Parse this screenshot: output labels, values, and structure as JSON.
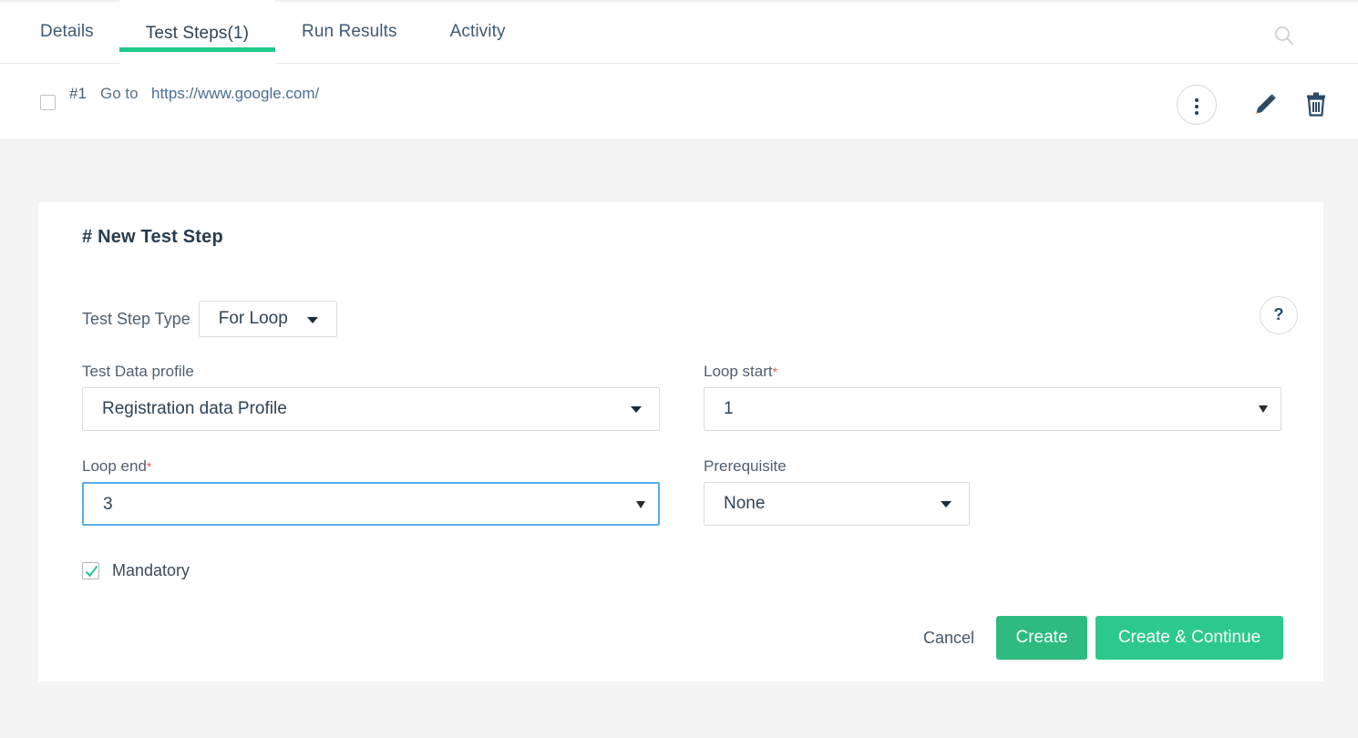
{
  "tabs": [
    {
      "label": "Details",
      "active": false
    },
    {
      "label": "Test Steps(1)",
      "active": true
    },
    {
      "label": "Run Results",
      "active": false
    },
    {
      "label": "Activity",
      "active": false
    }
  ],
  "toolbar": {
    "search_icon": "search-icon"
  },
  "step_row": {
    "number": "#1",
    "action": "Go to",
    "url": "https://www.google.com/",
    "more_icon": "vertical-dots-icon",
    "edit_icon": "pencil-icon",
    "delete_icon": "trash-icon"
  },
  "card": {
    "title": "# New Test Step",
    "help_icon": "question-mark-icon",
    "type_field": {
      "label": "Test Step Type",
      "value": "For Loop"
    },
    "fields": {
      "profile": {
        "label": "Test Data profile",
        "required": "",
        "value": "Registration data Profile"
      },
      "loop_start": {
        "label": "Loop start",
        "required": "*",
        "value": "1"
      },
      "loop_end": {
        "label": "Loop end",
        "required": "*",
        "value": "3"
      },
      "prerequisite": {
        "label": "Prerequisite",
        "required": "",
        "value": "None"
      }
    },
    "mandatory": {
      "label": "Mandatory",
      "checked": true
    },
    "actions": {
      "cancel": "Cancel",
      "create": "Create",
      "create_continue": "Create & Continue"
    }
  },
  "colors": {
    "accent_green": "#1fc98a",
    "button_green": "#2dbb80",
    "focus_blue": "#5aacea",
    "required_red": "#f0544c",
    "page_background": "#f4f4f4"
  }
}
